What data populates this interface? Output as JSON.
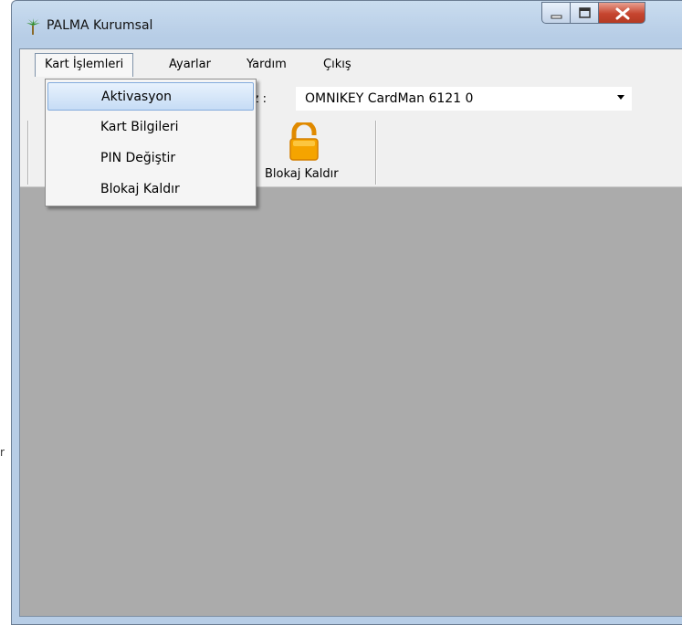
{
  "window": {
    "title": "PALMA Kurumsal",
    "icon": "palm-tree-icon"
  },
  "menubar": {
    "items": [
      {
        "label": "Kart İşlemleri",
        "open": true
      },
      {
        "label": "Ayarlar"
      },
      {
        "label": "Yardım"
      },
      {
        "label": "Çıkış"
      }
    ]
  },
  "dropdown": {
    "items": [
      {
        "label": "Aktivasyon",
        "highlighted": true
      },
      {
        "label": "Kart Bilgileri"
      },
      {
        "label": "PIN Değiştir"
      },
      {
        "label": "Blokaj Kaldır"
      }
    ]
  },
  "reader": {
    "label_partial": "eçiniz :",
    "selected": "OMNIKEY CardMan 6121 0"
  },
  "toolbar": {
    "partial_button_label": "ir",
    "unblock_button": {
      "label": "Blokaj Kaldır",
      "icon": "unlocked-padlock-icon"
    }
  },
  "stray_text": "r"
}
